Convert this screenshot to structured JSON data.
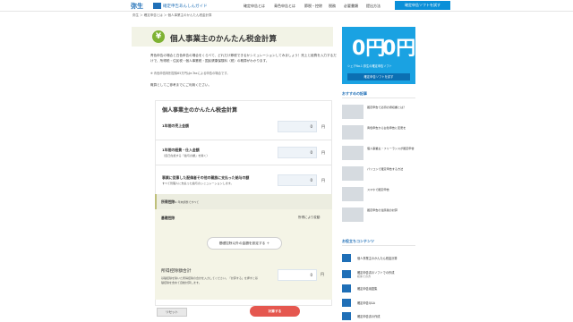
{
  "header": {
    "logo": "弥生",
    "site_name": "確定申告あんしんガイド",
    "nav": [
      "確定申告とは",
      "青色申告とは",
      "節税・控除",
      "税務",
      "必要書類",
      "提出方法"
    ],
    "cta": "確定申告ソフトを試す"
  },
  "breadcrumb": "弥生 ＞ 確定申告とは ＞ 個人事業主のかんたん税金計算",
  "page": {
    "icon": "¥",
    "title": "個人事業主のかんたん税金計算",
    "intro": "青色申告の場合と白色申告の場合をくらべて、どれだけ節税できるかシミュレーションしてみましょう！売上と経費を入力するだけで、所得税・住民税・個人事業税・国民健康保険料（税）の概算がわかります。",
    "note": "※ 青色申告特別控除65万円はe-Taxによる申告の場合です。",
    "lead": "概算としてご参考までにご利用ください。"
  },
  "calc": {
    "title": "個人事業主のかんたん税金計算",
    "rows": [
      {
        "label": "1年間の売上金額",
        "sub": "",
        "value": "0",
        "unit": "円"
      },
      {
        "label": "1年間の経費・仕入金額",
        "sub": "（自己負担する「給与の額」を除く）",
        "value": "0",
        "unit": "円"
      },
      {
        "label": "事業に従事した配偶者その他の親族に支払った給与の額",
        "sub": "すべて管理人に支払った給与のシミュレーションします。",
        "value": "0",
        "unit": "円"
      }
    ],
    "deduction": {
      "label": "所得控除",
      "sub": "※ 年末調整ですべて",
      "basic_label": "基礎控除",
      "basic_value": "所得により変動",
      "other_button": "基礎控除以外の金額を設定する ＋"
    },
    "total": {
      "label": "所得控除額合計",
      "note": "基礎控除を除いた所得控除の合計を入力してください。「計算する」を押すと基礎控除を含めて自動計算します。",
      "value": "0",
      "unit": "円"
    },
    "reset_button": "リセット",
    "calc_button": "計算する"
  },
  "sidebar": {
    "ad": {
      "zero_left": "0円",
      "zero_right": "0円",
      "copy": "シェアNo.1 弥生の確定申告ソフト",
      "button": "確定申告ソフトを試す"
    },
    "recommended_title": "おすすめの記事",
    "articles": [
      "確定申告で必須の領収書とは？",
      "青色申告から白色申告に変更を",
      "個人事業主・フリーランスが確定申告",
      "パソコンで確定申告する方法",
      "スマホで確定申告",
      "確定申告の住民税の計算"
    ],
    "contents_title": "お役立ちコンテンツ",
    "apps": [
      {
        "title": "個人事業主のかんたん税金計算",
        "sub": ""
      },
      {
        "title": "確定申告書のソフトでの作成",
        "sub": "初めての方"
      },
      {
        "title": "確定申告用語集",
        "sub": ""
      },
      {
        "title": "確定申告Q&A",
        "sub": ""
      },
      {
        "title": "確定申告書の作成",
        "sub": ""
      }
    ]
  }
}
